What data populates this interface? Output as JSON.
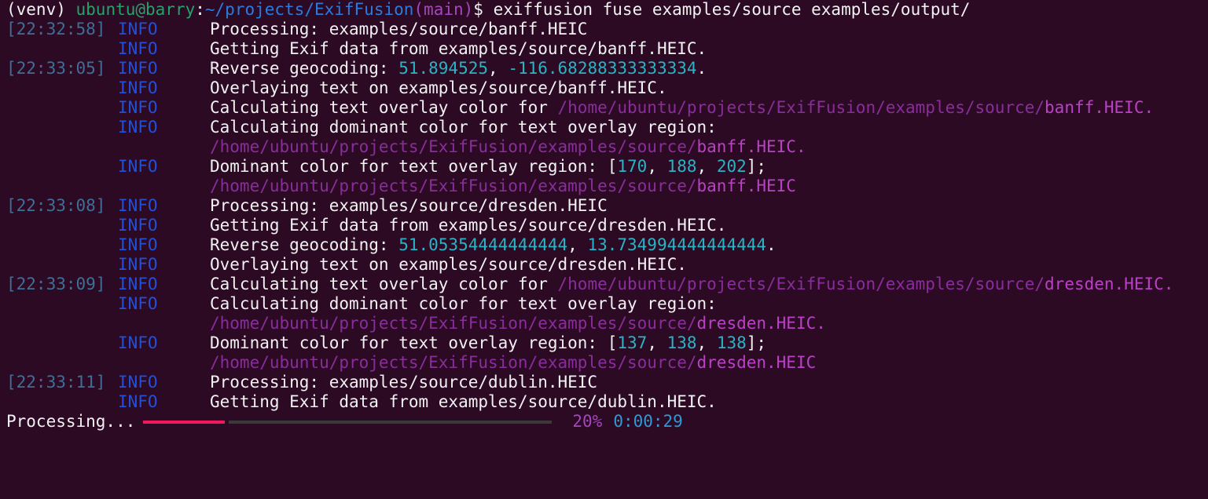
{
  "prompt": {
    "venv": "(venv) ",
    "user_host": "ubuntu@barry",
    "colon": ":",
    "path": "~/projects/ExifFusion",
    "branch": "(main)",
    "suffix": "$ ",
    "command": "exiffusion fuse examples/source examples/output/"
  },
  "log": [
    {
      "time": "[22:32:58]",
      "level": "INFO",
      "segments": [
        {
          "t": "Processing: examples/source/banff.HEIC",
          "c": "text"
        }
      ]
    },
    {
      "time": "",
      "level": "INFO",
      "segments": [
        {
          "t": "Getting Exif data from examples/source/banff.HEIC.",
          "c": "text"
        }
      ]
    },
    {
      "time": "[22:33:05]",
      "level": "INFO",
      "segments": [
        {
          "t": "Reverse geocoding: ",
          "c": "text"
        },
        {
          "t": "51.894525",
          "c": "num"
        },
        {
          "t": ", ",
          "c": "text"
        },
        {
          "t": "-116.68288333333334",
          "c": "num"
        },
        {
          "t": ".",
          "c": "text"
        }
      ]
    },
    {
      "time": "",
      "level": "INFO",
      "segments": [
        {
          "t": "Overlaying text on examples/source/banff.HEIC.",
          "c": "text"
        }
      ]
    },
    {
      "time": "",
      "level": "INFO",
      "segments": [
        {
          "t": "Calculating text overlay color for ",
          "c": "text"
        },
        {
          "t": "/home/ubuntu/projects/ExifFusion/examples/source/",
          "c": "pathdim"
        },
        {
          "t": "banff.HEIC.",
          "c": "pathfile"
        }
      ]
    },
    {
      "time": "",
      "level": "INFO",
      "segments": [
        {
          "t": "Calculating dominant color for text overlay region:",
          "c": "text"
        }
      ]
    },
    {
      "time": "",
      "level": "",
      "segments": [
        {
          "t": "/home/ubuntu/projects/ExifFusion/examples/source/",
          "c": "pathdim"
        },
        {
          "t": "banff.HEIC.",
          "c": "pathfile"
        }
      ]
    },
    {
      "time": "",
      "level": "INFO",
      "segments": [
        {
          "t": "Dominant color for text overlay region: [",
          "c": "text"
        },
        {
          "t": "170",
          "c": "num"
        },
        {
          "t": ", ",
          "c": "text"
        },
        {
          "t": "188",
          "c": "num"
        },
        {
          "t": ", ",
          "c": "text"
        },
        {
          "t": "202",
          "c": "num"
        },
        {
          "t": "];",
          "c": "text"
        }
      ]
    },
    {
      "time": "",
      "level": "",
      "segments": [
        {
          "t": "/home/ubuntu/projects/ExifFusion/examples/source/",
          "c": "pathdim"
        },
        {
          "t": "banff.HEIC",
          "c": "pathfile"
        }
      ]
    },
    {
      "time": "[22:33:08]",
      "level": "INFO",
      "segments": [
        {
          "t": "Processing: examples/source/dresden.HEIC",
          "c": "text"
        }
      ]
    },
    {
      "time": "",
      "level": "INFO",
      "segments": [
        {
          "t": "Getting Exif data from examples/source/dresden.HEIC.",
          "c": "text"
        }
      ]
    },
    {
      "time": "",
      "level": "INFO",
      "segments": [
        {
          "t": "Reverse geocoding: ",
          "c": "text"
        },
        {
          "t": "51.05354444444444",
          "c": "num"
        },
        {
          "t": ", ",
          "c": "text"
        },
        {
          "t": "13.734994444444444",
          "c": "num"
        },
        {
          "t": ".",
          "c": "text"
        }
      ]
    },
    {
      "time": "",
      "level": "INFO",
      "segments": [
        {
          "t": "Overlaying text on examples/source/dresden.HEIC.",
          "c": "text"
        }
      ]
    },
    {
      "time": "[22:33:09]",
      "level": "INFO",
      "segments": [
        {
          "t": "Calculating text overlay color for ",
          "c": "text"
        },
        {
          "t": "/home/ubuntu/projects/ExifFusion/examples/source/",
          "c": "pathdim"
        },
        {
          "t": "dresden.HEIC.",
          "c": "pathfile"
        }
      ]
    },
    {
      "time": "",
      "level": "INFO",
      "segments": [
        {
          "t": "Calculating dominant color for text overlay region:",
          "c": "text"
        }
      ]
    },
    {
      "time": "",
      "level": "",
      "segments": [
        {
          "t": "/home/ubuntu/projects/ExifFusion/examples/source/",
          "c": "pathdim"
        },
        {
          "t": "dresden.HEIC.",
          "c": "pathfile"
        }
      ]
    },
    {
      "time": "",
      "level": "INFO",
      "segments": [
        {
          "t": "Dominant color for text overlay region: [",
          "c": "text"
        },
        {
          "t": "137",
          "c": "num"
        },
        {
          "t": ", ",
          "c": "text"
        },
        {
          "t": "138",
          "c": "num"
        },
        {
          "t": ", ",
          "c": "text"
        },
        {
          "t": "138",
          "c": "num"
        },
        {
          "t": "];",
          "c": "text"
        }
      ]
    },
    {
      "time": "",
      "level": "",
      "segments": [
        {
          "t": "/home/ubuntu/projects/ExifFusion/examples/source/",
          "c": "pathdim"
        },
        {
          "t": "dresden.HEIC",
          "c": "pathfile"
        }
      ]
    },
    {
      "time": "[22:33:11]",
      "level": "INFO",
      "segments": [
        {
          "t": "Processing: examples/source/dublin.HEIC",
          "c": "text"
        }
      ]
    },
    {
      "time": "",
      "level": "INFO",
      "segments": [
        {
          "t": "Getting Exif data from examples/source/dublin.HEIC.",
          "c": "text"
        }
      ]
    }
  ],
  "progress": {
    "label": "Processing...",
    "fraction": 0.2,
    "percent_text": "20%",
    "elapsed": "0:00:29"
  },
  "colors": {
    "background": "#2c0a24",
    "timestamp": "#3f6e98",
    "level": "#2250d8",
    "number": "#2ab3c4",
    "path": "#8a2d9c",
    "filename": "#bb40c8",
    "bar_fill": "#f0195e",
    "bar_track": "#3a3a3a"
  }
}
